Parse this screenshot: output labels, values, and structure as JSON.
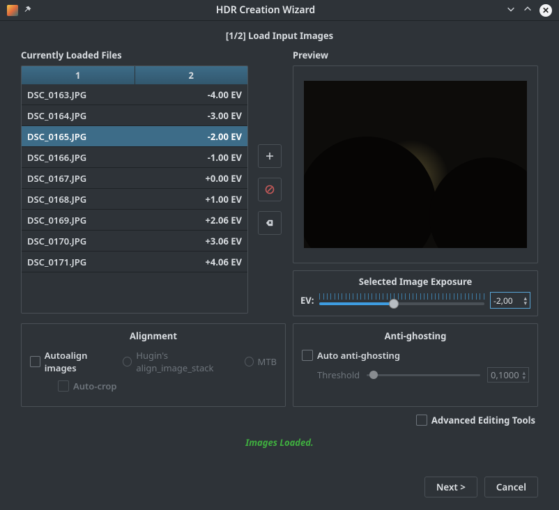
{
  "window": {
    "title": "HDR Creation Wizard"
  },
  "step": {
    "label": "[1/2] Load Input Images"
  },
  "files": {
    "section_label": "Currently Loaded Files",
    "columns": [
      "1",
      "2"
    ],
    "selected_index": 2,
    "rows": [
      {
        "name": "DSC_0163.JPG",
        "ev": "-4.00 EV"
      },
      {
        "name": "DSC_0164.JPG",
        "ev": "-3.00 EV"
      },
      {
        "name": "DSC_0165.JPG",
        "ev": "-2.00 EV"
      },
      {
        "name": "DSC_0166.JPG",
        "ev": "-1.00 EV"
      },
      {
        "name": "DSC_0167.JPG",
        "ev": "+0.00 EV"
      },
      {
        "name": "DSC_0168.JPG",
        "ev": "+1.00 EV"
      },
      {
        "name": "DSC_0169.JPG",
        "ev": "+2.06 EV"
      },
      {
        "name": "DSC_0170.JPG",
        "ev": "+3.06 EV"
      },
      {
        "name": "DSC_0171.JPG",
        "ev": "+4.06 EV"
      }
    ]
  },
  "preview": {
    "label": "Preview"
  },
  "exposure": {
    "title": "Selected Image Exposure",
    "ev_label": "EV:",
    "value": "-2,00"
  },
  "alignment": {
    "title": "Alignment",
    "autoalign": "Autoalign images",
    "hugin": "Hugin's align_image_stack",
    "mtb": "MTB",
    "autocrop": "Auto-crop"
  },
  "antighost": {
    "title": "Anti-ghosting",
    "auto": "Auto anti-ghosting",
    "threshold_label": "Threshold",
    "threshold_value": "0,1000"
  },
  "advanced": {
    "label": "Advanced Editing Tools"
  },
  "status": {
    "text": "Images Loaded."
  },
  "buttons": {
    "next": "Next >",
    "cancel": "Cancel"
  }
}
